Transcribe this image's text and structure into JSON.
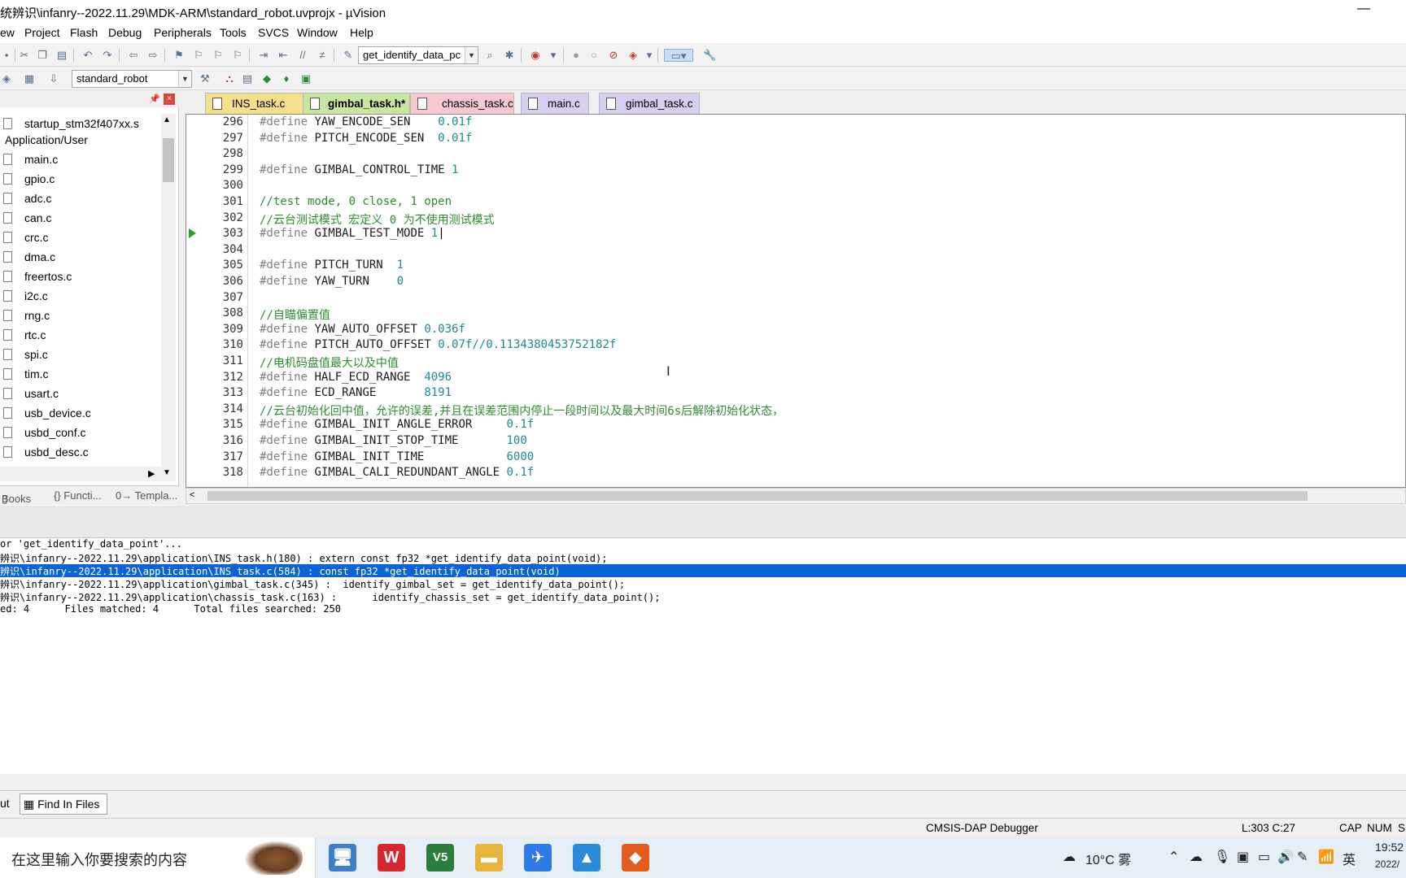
{
  "window": {
    "title": "统辨识\\infanry--2022.11.29\\MDK-ARM\\standard_robot.uvprojx - µVision",
    "minimize_glyph": "—"
  },
  "menu": [
    "ew",
    "Project",
    "Flash",
    "Debug",
    "Peripherals",
    "Tools",
    "SVCS",
    "Window",
    "Help"
  ],
  "toolbar1": {
    "find_combo_value": "get_identify_data_pc"
  },
  "toolbar2": {
    "target_combo_value": "standard_robot"
  },
  "project_panel": {
    "items": [
      {
        "type": "file",
        "name": "startup_stm32f407xx.s"
      },
      {
        "type": "group",
        "name": "Application/User"
      },
      {
        "type": "file",
        "name": "main.c"
      },
      {
        "type": "file",
        "name": "gpio.c"
      },
      {
        "type": "file",
        "name": "adc.c"
      },
      {
        "type": "file",
        "name": "can.c"
      },
      {
        "type": "file",
        "name": "crc.c"
      },
      {
        "type": "file",
        "name": "dma.c"
      },
      {
        "type": "file",
        "name": "freertos.c"
      },
      {
        "type": "file",
        "name": "i2c.c"
      },
      {
        "type": "file",
        "name": "rng.c"
      },
      {
        "type": "file",
        "name": "rtc.c"
      },
      {
        "type": "file",
        "name": "spi.c"
      },
      {
        "type": "file",
        "name": "tim.c"
      },
      {
        "type": "file",
        "name": "usart.c"
      },
      {
        "type": "file",
        "name": "usb_device.c"
      },
      {
        "type": "file",
        "name": "usbd_conf.c"
      },
      {
        "type": "file",
        "name": "usbd_desc.c"
      }
    ],
    "bottom_tabs": [
      "Books",
      "{} Functi...",
      "0→ Templa..."
    ],
    "pin_glyph": "📌",
    "close_glyph": "×"
  },
  "editor_tabs": [
    {
      "label": "INS_task.c",
      "color": "#f4df8c",
      "active": false
    },
    {
      "label": "gimbal_task.h*",
      "color": "#c8e6a0",
      "active": true
    },
    {
      "label": "chassis_task.c",
      "color": "#f7c9cf",
      "active": false
    },
    {
      "label": "main.c",
      "color": "#d8cfee",
      "active": false
    },
    {
      "label": "gimbal_task.c",
      "color": "#d8cfee",
      "active": false
    }
  ],
  "code_lines": [
    {
      "n": "296",
      "kw": "#define",
      "id": "YAW_ENCODE_SEN",
      "pad": "    ",
      "val": "0.01f",
      "cmt": ""
    },
    {
      "n": "297",
      "kw": "#define",
      "id": "PITCH_ENCODE_SEN",
      "pad": "  ",
      "val": "0.01f",
      "cmt": ""
    },
    {
      "n": "298",
      "kw": "",
      "id": "",
      "pad": "",
      "val": "",
      "cmt": ""
    },
    {
      "n": "299",
      "kw": "#define",
      "id": "GIMBAL_CONTROL_TIME",
      "pad": " ",
      "val": "1",
      "cmt": ""
    },
    {
      "n": "300",
      "kw": "",
      "id": "",
      "pad": "",
      "val": "",
      "cmt": ""
    },
    {
      "n": "301",
      "kw": "",
      "id": "",
      "pad": "",
      "val": "",
      "cmt": "//test mode, 0 close, 1 open"
    },
    {
      "n": "302",
      "kw": "",
      "id": "",
      "pad": "",
      "val": "",
      "cmt": "//云台测试模式 宏定义 0 为不使用测试模式"
    },
    {
      "n": "303",
      "kw": "#define",
      "id": "GIMBAL_TEST_MODE",
      "pad": " ",
      "val": "1",
      "cmt": "",
      "marker": true,
      "cursor": true
    },
    {
      "n": "304",
      "kw": "",
      "id": "",
      "pad": "",
      "val": "",
      "cmt": ""
    },
    {
      "n": "305",
      "kw": "#define",
      "id": "PITCH_TURN",
      "pad": "  ",
      "val": "1",
      "cmt": ""
    },
    {
      "n": "306",
      "kw": "#define",
      "id": "YAW_TURN",
      "pad": "    ",
      "val": "0",
      "cmt": ""
    },
    {
      "n": "307",
      "kw": "",
      "id": "",
      "pad": "",
      "val": "",
      "cmt": ""
    },
    {
      "n": "308",
      "kw": "",
      "id": "",
      "pad": "",
      "val": "",
      "cmt": "//自瞄偏置值"
    },
    {
      "n": "309",
      "kw": "#define",
      "id": "YAW_AUTO_OFFSET",
      "pad": " ",
      "val": "0.036f",
      "cmt": ""
    },
    {
      "n": "310",
      "kw": "#define",
      "id": "PITCH_AUTO_OFFSET",
      "pad": " ",
      "val": "0.07f//0.1134380453752182f",
      "cmt": ""
    },
    {
      "n": "311",
      "kw": "",
      "id": "",
      "pad": "",
      "val": "",
      "cmt": "//电机码盘值最大以及中值"
    },
    {
      "n": "312",
      "kw": "#define",
      "id": "HALF_ECD_RANGE",
      "pad": "  ",
      "val": "4096",
      "cmt": ""
    },
    {
      "n": "313",
      "kw": "#define",
      "id": "ECD_RANGE",
      "pad": "       ",
      "val": "8191",
      "cmt": ""
    },
    {
      "n": "314",
      "kw": "",
      "id": "",
      "pad": "",
      "val": "",
      "cmt": "//云台初始化回中值，允许的误差,并且在误差范围内停止一段时间以及最大时间6s后解除初始化状态，"
    },
    {
      "n": "315",
      "kw": "#define",
      "id": "GIMBAL_INIT_ANGLE_ERROR",
      "pad": "     ",
      "val": "0.1f",
      "cmt": ""
    },
    {
      "n": "316",
      "kw": "#define",
      "id": "GIMBAL_INIT_STOP_TIME",
      "pad": "       ",
      "val": "100",
      "cmt": ""
    },
    {
      "n": "317",
      "kw": "#define",
      "id": "GIMBAL_INIT_TIME",
      "pad": "            ",
      "val": "6000",
      "cmt": ""
    },
    {
      "n": "318",
      "kw": "#define",
      "id": "GIMBAL_CALI_REDUNDANT_ANGLE",
      "pad": " ",
      "val": "0.1f",
      "cmt": ""
    }
  ],
  "editor_scroll": {
    "left_glyph": "<"
  },
  "output_lines": [
    {
      "text": "or 'get_identify_data_point'...",
      "selected": false
    },
    {
      "text": "辨识\\infanry--2022.11.29\\application\\INS_task.h(180) : extern const fp32 *get_identify_data_point(void);",
      "selected": false
    },
    {
      "text": "辨识\\infanry--2022.11.29\\application\\INS_task.c(584) : const fp32 *get_identify_data_point(void)",
      "selected": true
    },
    {
      "text": "辨识\\infanry--2022.11.29\\application\\gimbal_task.c(345) :  identify_gimbal_set = get_identify_data_point();",
      "selected": false
    },
    {
      "text": "辨识\\infanry--2022.11.29\\application\\chassis_task.c(163) :      identify_chassis_set = get_identify_data_point();",
      "selected": false
    },
    {
      "text": "ed: 4      Files matched: 4      Total files searched: 250",
      "selected": false
    }
  ],
  "output_tabs": [
    {
      "label": "ut",
      "active": false
    },
    {
      "label": "Find In Files",
      "active": true
    }
  ],
  "status": {
    "debugger": "CMSIS-DAP Debugger",
    "position": "L:303 C:27",
    "caps": "CAP",
    "num": "NUM",
    "scrl": "S"
  },
  "taskbar": {
    "search_placeholder": "在这里输入你要搜索的内容",
    "apps": [
      {
        "name": "explorer-computer",
        "glyph": "🖥",
        "color": "#3f7fc8"
      },
      {
        "name": "wps",
        "glyph": "W",
        "color": "#d7282f"
      },
      {
        "name": "keil",
        "glyph": "V5",
        "color": "#2a7d3a"
      },
      {
        "name": "folder",
        "glyph": "📁",
        "color": "#e7b43c"
      },
      {
        "name": "feishu",
        "glyph": "✈",
        "color": "#2d7be5"
      },
      {
        "name": "photos",
        "glyph": "▲",
        "color": "#2b8ad9"
      },
      {
        "name": "matlab",
        "glyph": "◆",
        "color": "#e35c1e"
      }
    ],
    "weather": "10°C 雾",
    "lang": "英",
    "time": "19:52",
    "date": "2022/"
  }
}
